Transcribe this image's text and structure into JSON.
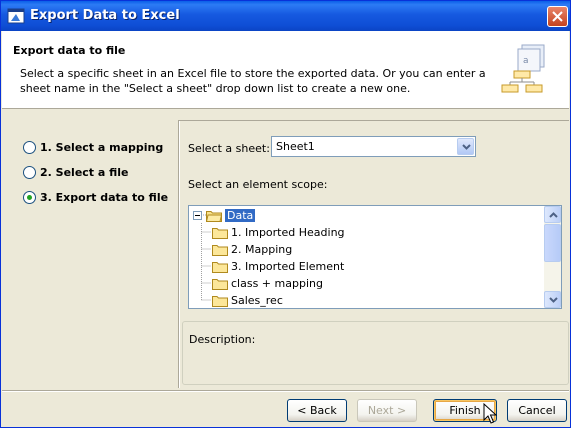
{
  "window": {
    "title": "Export Data to Excel"
  },
  "header": {
    "title": "Export data to file",
    "description": "Select a specific sheet in an Excel file to store the exported data. Or you can enter a sheet name in the \"Select a sheet\" drop down list to create a new one."
  },
  "steps": [
    {
      "label": "1. Select a mapping",
      "selected": false
    },
    {
      "label": "2. Select a file",
      "selected": false
    },
    {
      "label": "3. Export data to file",
      "selected": true
    }
  ],
  "sheet": {
    "label": "Select a sheet:",
    "value": "Sheet1"
  },
  "scope": {
    "label": "Select an element scope:",
    "root": "Data",
    "items": [
      "1. Imported Heading",
      "2. Mapping",
      "3. Imported Element",
      "class + mapping",
      "Sales_rec"
    ]
  },
  "description": {
    "label": "Description:"
  },
  "buttons": {
    "back": "< Back",
    "next": "Next >",
    "finish": "Finish",
    "cancel": "Cancel"
  },
  "colors": {
    "titlebar": "#0A5FE8",
    "selection": "#316AC5",
    "dialog_bg": "#ECE9D8"
  }
}
